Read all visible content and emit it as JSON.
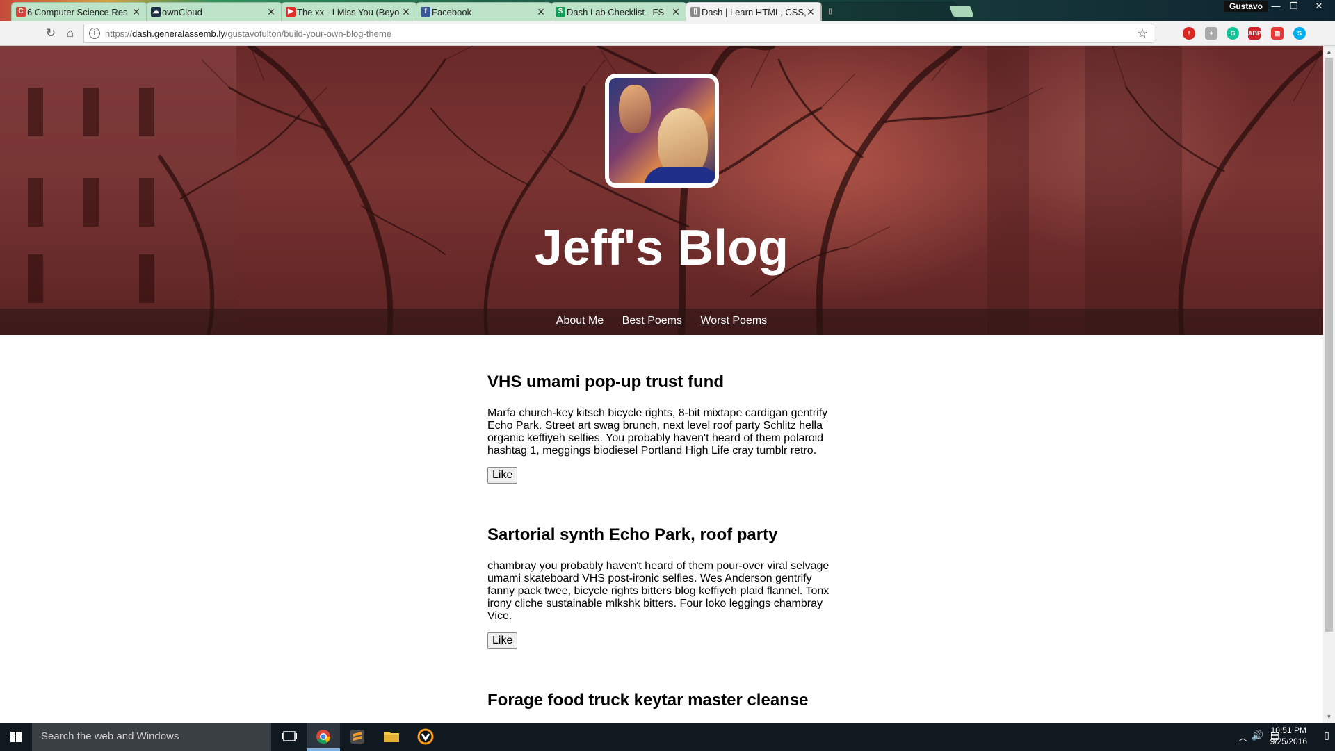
{
  "browser": {
    "tabs": [
      {
        "title": "6 Computer Science Res",
        "icon": "c-icon",
        "color": "#d9423a"
      },
      {
        "title": "ownCloud",
        "icon": "cloud-icon",
        "color": "#1d2d44"
      },
      {
        "title": "The xx - I Miss You (Beyo",
        "icon": "youtube-icon",
        "color": "#e52d27"
      },
      {
        "title": "Facebook",
        "icon": "facebook-icon",
        "color": "#3b5998"
      },
      {
        "title": "Dash Lab Checklist - FS",
        "icon": "sheets-icon",
        "color": "#0f9d58"
      },
      {
        "title": "Dash | Learn HTML, CSS,",
        "icon": "page-icon",
        "color": "#777777"
      },
      {
        "title": "",
        "icon": "page-icon",
        "color": "#777777"
      }
    ],
    "user": "Gustavo",
    "url_scheme": "https://",
    "url_host": "dash.generalassemb.ly",
    "url_path": "/gustavofulton/build-your-own-blog-theme"
  },
  "page": {
    "title": "Jeff's Blog",
    "nav": [
      "About Me",
      "Best Poems",
      "Worst Poems"
    ],
    "posts": [
      {
        "title": "VHS umami pop-up trust fund",
        "body": "Marfa church-key kitsch bicycle rights, 8-bit mixtape cardigan gentrify Echo Park. Street art swag brunch, next level roof party Schlitz hella organic keffiyeh selfies. You probably haven't heard of them polaroid hashtag 1, meggings biodiesel Portland High Life cray tumblr retro.",
        "button": "Like"
      },
      {
        "title": "Sartorial synth Echo Park, roof party",
        "body": "chambray you probably haven't heard of them pour-over viral selvage umami skateboard VHS post-ironic selfies. Wes Anderson gentrify fanny pack twee, bicycle rights bitters blog keffiyeh plaid flannel. Tonx irony cliche sustainable mlkshk bitters. Four loko leggings chambray Vice.",
        "button": "Like"
      },
      {
        "title": "Forage food truck keytar master cleanse",
        "body": "",
        "button": ""
      }
    ]
  },
  "taskbar": {
    "search_placeholder": "Search the web and Windows",
    "time": "10:51 PM",
    "date": "9/25/2016"
  }
}
